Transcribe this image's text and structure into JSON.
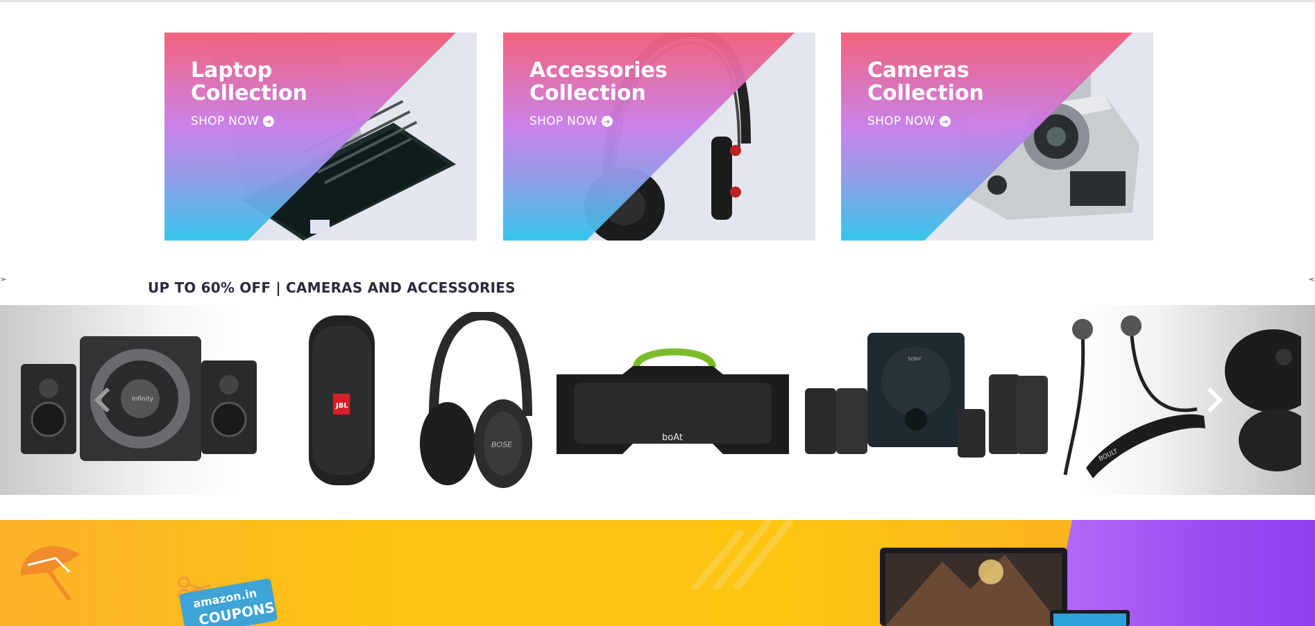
{
  "collections": [
    {
      "title_line1": "Laptop",
      "title_line2": "Collection",
      "cta": "SHOP NOW",
      "cta_icon": "arrow-circle-right-icon"
    },
    {
      "title_line1": "Accessories",
      "title_line2": "Collection",
      "cta": "SHOP NOW",
      "cta_icon": "arrow-circle-right-icon"
    },
    {
      "title_line1": "Cameras",
      "title_line2": "Collection",
      "cta": "SHOP NOW",
      "cta_icon": "arrow-circle-right-icon"
    }
  ],
  "deals": {
    "heading": "UP TO 60% OFF | CAMERAS AND ACCESSORIES",
    "products": [
      {
        "name": "speaker-system",
        "brand": "Infinity"
      },
      {
        "name": "portable-speaker",
        "brand": "JBL"
      },
      {
        "name": "headphones",
        "brand": "BOSE"
      },
      {
        "name": "boombox-speaker",
        "brand": "boAt"
      },
      {
        "name": "home-theater",
        "brand": "SONY"
      },
      {
        "name": "neckband-earphones",
        "brand": "BOULT"
      },
      {
        "name": "wireless-earbuds",
        "brand": ""
      }
    ],
    "prev_icon": "chevron-left-icon",
    "next_icon": "chevron-right-icon"
  },
  "promo": {
    "coupon_brand": "amazon.in",
    "coupon_label": "COUPONS",
    "icons": [
      "umbrella-icon",
      "scissors-icon",
      "laptop-image"
    ],
    "colors": {
      "yellow": "#fcc312",
      "purple": "#9b4cf3"
    }
  },
  "colors": {
    "gradient_top": "#f35e78",
    "gradient_mid": "#c97ee9",
    "gradient_bottom": "#2fc4ea",
    "heading_text": "#2b2b3c"
  }
}
